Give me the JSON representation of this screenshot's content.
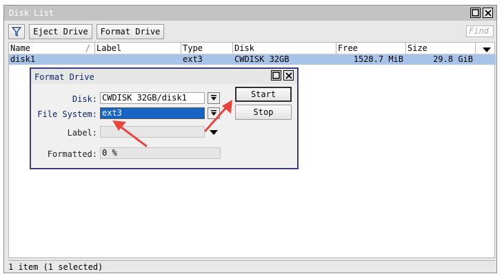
{
  "window": {
    "title": "Disk List",
    "toolbar": {
      "eject_label": "Eject Drive",
      "format_label": "Format Drive",
      "find_placeholder": "Find"
    },
    "columns": [
      "Name",
      "Label",
      "Type",
      "Disk",
      "Free",
      "Size"
    ],
    "rows": [
      {
        "name": "disk1",
        "label": "",
        "type": "ext3",
        "disk": "CWDISK 32GB",
        "free": "1528.7 MiB",
        "size": "29.8 GiB"
      }
    ],
    "status": "1 item (1 selected)"
  },
  "dialog": {
    "title": "Format Drive",
    "disk_label": "Disk:",
    "disk_value": "CWDISK 32GB/disk1",
    "fs_label": "File System:",
    "fs_value": "ext3",
    "label_label": "Label:",
    "label_value": "",
    "formatted_label": "Formatted:",
    "formatted_value": "0 %",
    "start_label": "Start",
    "stop_label": "Stop"
  },
  "colors": {
    "selection": "#1665c5",
    "row_highlight": "#a8c3e8",
    "arrow": "#e8453c",
    "dialog_border": "#3b3b80"
  },
  "icons": [
    "filter-icon",
    "maximize-icon",
    "close-icon",
    "dropdown-arrow-icon",
    "column-menu-icon",
    "annotation-arrow"
  ]
}
